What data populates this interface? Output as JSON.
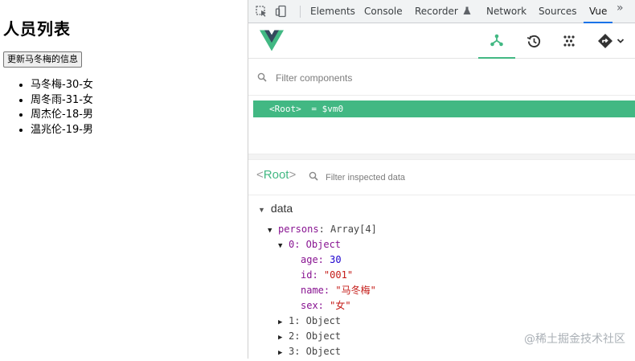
{
  "page": {
    "title": "人员列表",
    "update_button": "更新马冬梅的信息",
    "persons": [
      "马冬梅-30-女",
      "周冬雨-31-女",
      "周杰伦-18-男",
      "温兆伦-19-男"
    ]
  },
  "devtools": {
    "tabs": [
      "Elements",
      "Console",
      "Recorder",
      "Network",
      "Sources",
      "Vue"
    ],
    "active_tab": "Vue",
    "more_label": "»",
    "icons": [
      "inspect-element-icon",
      "device-toolbar-icon",
      "flask-icon",
      "components-icon",
      "history-icon",
      "timeline-icon",
      "routes-icon",
      "chevron-down-icon"
    ],
    "filter_placeholder": "Filter components",
    "tree": {
      "root_label": "<Root>",
      "root_suffix": "= $vm0"
    },
    "inspector": {
      "title_open": "<",
      "title_name": "Root",
      "title_close": ">",
      "filter_placeholder": "Filter inspected data",
      "section": "data",
      "persons_key": "persons",
      "persons_type": "Array[4]",
      "item0": {
        "label": "0: Object",
        "age_key": "age:",
        "age_val": "30",
        "id_key": "id:",
        "id_val": "\"001\"",
        "name_key": "name:",
        "name_val": "\"马冬梅\"",
        "sex_key": "sex:",
        "sex_val": "\"女\""
      },
      "collapsed_items": [
        "1: Object",
        "2: Object",
        "3: Object"
      ]
    },
    "colors": {
      "vue_green": "#42b883",
      "key_purple": "#881391",
      "number_blue": "#1c00cf",
      "string_red": "#c41a16"
    }
  },
  "watermark": "@稀土掘金技术社区"
}
